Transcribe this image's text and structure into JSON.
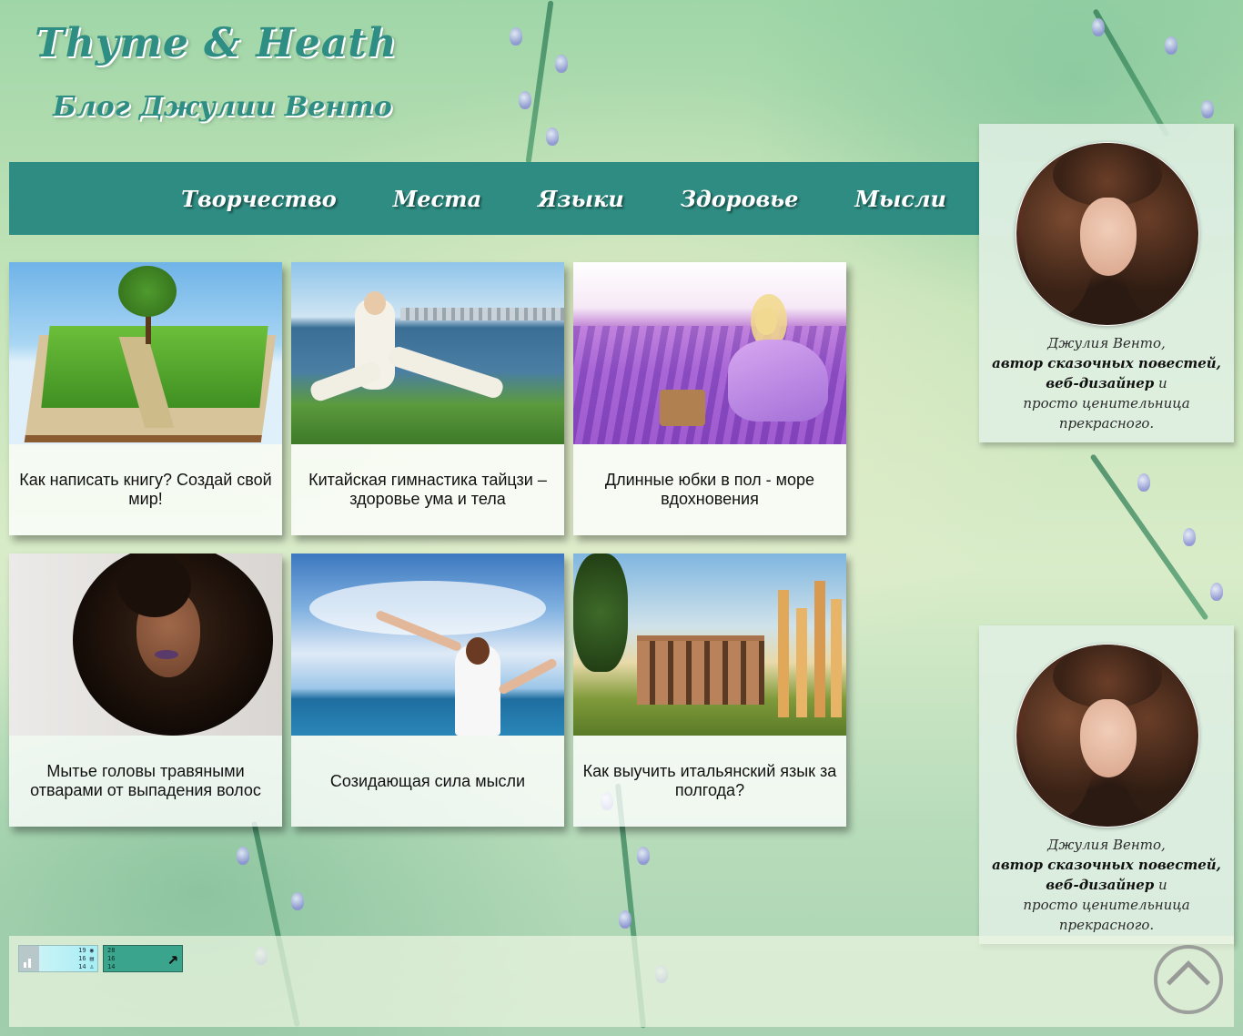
{
  "header": {
    "site_title": "Thyme & Heath",
    "site_subtitle": "Блог Джулии Венто"
  },
  "nav": {
    "items": [
      "Творчество",
      "Места",
      "Языки",
      "Здоровье",
      "Мысли"
    ]
  },
  "posts": [
    {
      "title": "Как написать книгу? Создай свой мир!",
      "image": "open-book-with-meadow-image"
    },
    {
      "title": "Китайская гимнастика тайцзи – здоровье ума и тела",
      "image": "tai-chi-man-by-lake-image"
    },
    {
      "title": "Длинные юбки в пол - море вдохновения",
      "image": "lavender-field-bicycle-image"
    },
    {
      "title": "Мытье головы травяными отварами от выпадения волос",
      "image": "curly-hair-woman-image"
    },
    {
      "title": "Созидающая сила мысли",
      "image": "woman-arms-raised-sea-image"
    },
    {
      "title": "Как выучить итальянский язык за полгода?",
      "image": "colosseum-ruins-image"
    }
  ],
  "profile": {
    "name_line": "Джулия Венто,",
    "role1": "автор сказочных повестей,",
    "role2": "веб-дизайнер",
    "and": "и",
    "line4": "просто ценительница",
    "line5": "прекрасного."
  },
  "counters": {
    "c1": [
      "19",
      "16",
      "14"
    ],
    "c2": [
      "28",
      "16",
      "14"
    ]
  },
  "colors": {
    "accent": "#2e8c82",
    "title": "#2f8e84"
  }
}
